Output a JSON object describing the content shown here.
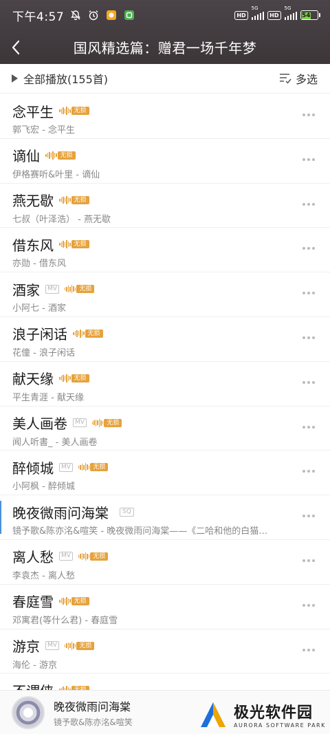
{
  "status_bar": {
    "time": "下午4:57",
    "network_type_1": "5G",
    "network_type_2": "5G",
    "hd_label": "HD",
    "battery": "54"
  },
  "header": {
    "title": "国风精选篇：赠君一场千年梦"
  },
  "toolbar": {
    "play_all": "全部播放(155首)",
    "multi_select": "多选"
  },
  "badges": {
    "lossless": "无损",
    "mv": "MV",
    "sq": "SQ"
  },
  "songs": [
    {
      "title": "念平生",
      "subtitle": "郭飞宏 - 念平生",
      "mv": false,
      "lossless": true,
      "sq": false
    },
    {
      "title": "谪仙",
      "subtitle": "伊格赛听&叶里 - 谪仙",
      "mv": false,
      "lossless": true,
      "sq": false
    },
    {
      "title": "燕无歇",
      "subtitle": "七叔（叶泽浩） - 燕无歇",
      "mv": false,
      "lossless": true,
      "sq": false
    },
    {
      "title": "借东风",
      "subtitle": "亦勋 - 借东风",
      "mv": false,
      "lossless": true,
      "sq": false
    },
    {
      "title": "酒家",
      "subtitle": "小阿七 - 酒家",
      "mv": true,
      "lossless": true,
      "sq": false
    },
    {
      "title": "浪子闲话",
      "subtitle": "花僮 - 浪子闲话",
      "mv": false,
      "lossless": true,
      "sq": false
    },
    {
      "title": "献天缘",
      "subtitle": "平生青涯 - 献天缘",
      "mv": false,
      "lossless": true,
      "sq": false
    },
    {
      "title": "美人画卷",
      "subtitle": "闻人听書_ - 美人画卷",
      "mv": true,
      "lossless": true,
      "sq": false
    },
    {
      "title": "醉倾城",
      "subtitle": "小阿枫 - 醉倾城",
      "mv": true,
      "lossless": true,
      "sq": false
    },
    {
      "title": "晚夜微雨问海棠",
      "subtitle": "镜予歌&陈亦洺&喧笑 - 晚夜微雨问海棠——《二哈和他的白猫…",
      "mv": false,
      "lossless": false,
      "sq": true,
      "active": true
    },
    {
      "title": "离人愁",
      "subtitle": "李袁杰 - 离人愁",
      "mv": true,
      "lossless": true,
      "sq": false
    },
    {
      "title": "春庭雪",
      "subtitle": "邓寓君(等什么君) - 春庭雪",
      "mv": false,
      "lossless": true,
      "sq": false
    },
    {
      "title": "游京",
      "subtitle": "海伦 - 游京",
      "mv": true,
      "lossless": true,
      "sq": false
    },
    {
      "title": "不谓侠",
      "subtitle": "",
      "mv": false,
      "lossless": true,
      "sq": false
    }
  ],
  "player": {
    "title": "晚夜微雨问海棠",
    "artist": "镜予歌&陈亦洺&喧笑"
  },
  "watermark": {
    "name_cn": "极光软件园",
    "name_en": "AURORA SOFTWARE PARK"
  },
  "colors": {
    "header_bg": "#433c40",
    "lossless_badge": "#e6a23c",
    "battery_fill": "#7fd34f"
  }
}
